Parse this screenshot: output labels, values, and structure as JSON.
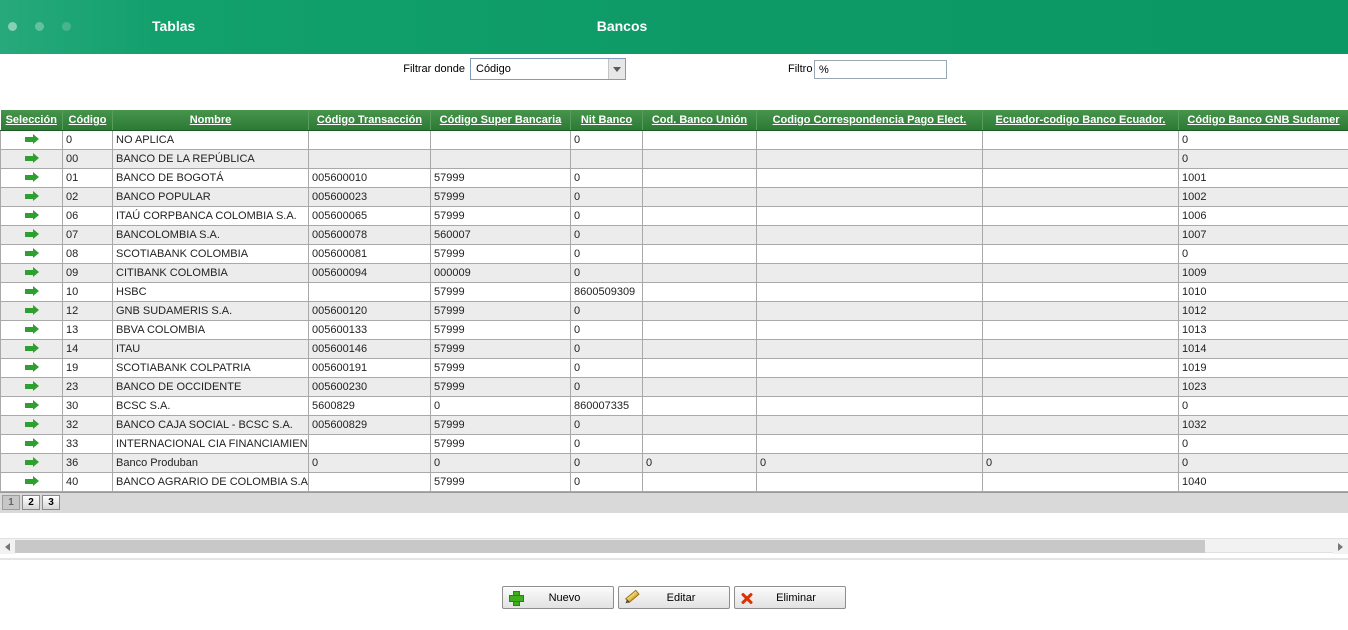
{
  "colors": {
    "topbar_green": "#0d9a66",
    "table_header_green": "#2e7d36",
    "arrow_green": "#2fa02f",
    "delete_red": "#e03000",
    "pencil_yellow": "#d9a81f"
  },
  "header": {
    "left_title": "Tablas",
    "center_title": "Bancos"
  },
  "filter": {
    "where_label": "Filtrar donde",
    "where_value": "Código",
    "filter_label": "Filtro",
    "filter_value": "%"
  },
  "table": {
    "columns": [
      "Selección",
      "Código",
      "Nombre",
      "Código Transacción",
      "Código Super Bancaria",
      "Nit Banco",
      "Cod. Banco Unión",
      "Codigo Correspondencia Pago Elect.",
      "Ecuador-codigo Banco Ecuador.",
      "Código Banco GNB Sudamer"
    ],
    "rows": [
      [
        "0",
        "NO APLICA",
        "",
        "",
        "0",
        "",
        "",
        "",
        "0"
      ],
      [
        "00",
        "BANCO DE LA REPÚBLICA",
        "",
        "",
        "",
        "",
        "",
        "",
        "0"
      ],
      [
        "01",
        "BANCO DE BOGOTÁ",
        "005600010",
        "57999",
        "0",
        "",
        "",
        "",
        "1001"
      ],
      [
        "02",
        "BANCO POPULAR",
        "005600023",
        "57999",
        "0",
        "",
        "",
        "",
        "1002"
      ],
      [
        "06",
        "ITAÚ CORPBANCA COLOMBIA S.A.",
        "005600065",
        "57999",
        "0",
        "",
        "",
        "",
        "1006"
      ],
      [
        "07",
        "BANCOLOMBIA S.A.",
        "005600078",
        "560007",
        "0",
        "",
        "",
        "",
        "1007"
      ],
      [
        "08",
        "SCOTIABANK COLOMBIA",
        "005600081",
        "57999",
        "0",
        "",
        "",
        "",
        "0"
      ],
      [
        "09",
        "CITIBANK COLOMBIA",
        "005600094",
        "000009",
        "0",
        "",
        "",
        "",
        "1009"
      ],
      [
        "10",
        "HSBC",
        "",
        "57999",
        "8600509309",
        "",
        "",
        "",
        "1010"
      ],
      [
        "12",
        "GNB SUDAMERIS S.A.",
        "005600120",
        "57999",
        "0",
        "",
        "",
        "",
        "1012"
      ],
      [
        "13",
        "BBVA COLOMBIA",
        "005600133",
        "57999",
        "0",
        "",
        "",
        "",
        "1013"
      ],
      [
        "14",
        "ITAU",
        "005600146",
        "57999",
        "0",
        "",
        "",
        "",
        "1014"
      ],
      [
        "19",
        "SCOTIABANK COLPATRIA",
        "005600191",
        "57999",
        "0",
        "",
        "",
        "",
        "1019"
      ],
      [
        "23",
        "BANCO DE OCCIDENTE",
        "005600230",
        "57999",
        "0",
        "",
        "",
        "",
        "1023"
      ],
      [
        "30",
        "BCSC S.A.",
        "5600829",
        "0",
        "860007335",
        "",
        "",
        "",
        "0"
      ],
      [
        "32",
        "BANCO CAJA SOCIAL - BCSC S.A.",
        "005600829",
        "57999",
        "0",
        "",
        "",
        "",
        "1032"
      ],
      [
        "33",
        "INTERNACIONAL CIA FINANCIAMIEN",
        "",
        "57999",
        "0",
        "",
        "",
        "",
        "0"
      ],
      [
        "36",
        "Banco Produban",
        "0",
        "0",
        "0",
        "0",
        "0",
        "0",
        "0"
      ],
      [
        "40",
        "BANCO AGRARIO DE COLOMBIA S.A.",
        "",
        "57999",
        "0",
        "",
        "",
        "",
        "1040"
      ]
    ]
  },
  "pagination": {
    "pages": [
      "1",
      "2",
      "3"
    ],
    "active": "1"
  },
  "actions": [
    {
      "name": "new-button",
      "label": "Nuevo",
      "icon": "plus-icon"
    },
    {
      "name": "edit-button",
      "label": "Editar",
      "icon": "pencil-icon"
    },
    {
      "name": "delete-button",
      "label": "Eliminar",
      "icon": "x-icon"
    }
  ]
}
